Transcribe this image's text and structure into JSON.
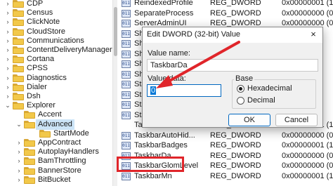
{
  "tree": {
    "items": [
      {
        "label": "CDP",
        "level": 1,
        "expanded": false
      },
      {
        "label": "Census",
        "level": 1,
        "expanded": false
      },
      {
        "label": "ClickNote",
        "level": 1,
        "expanded": false
      },
      {
        "label": "CloudStore",
        "level": 1,
        "expanded": false
      },
      {
        "label": "Communications",
        "level": 1,
        "expanded": false
      },
      {
        "label": "ContentDeliveryManager",
        "level": 1,
        "expanded": false
      },
      {
        "label": "Cortana",
        "level": 1,
        "expanded": false
      },
      {
        "label": "CPSS",
        "level": 1,
        "expanded": false
      },
      {
        "label": "Diagnostics",
        "level": 1,
        "expanded": false
      },
      {
        "label": "Dialer",
        "level": 1,
        "expanded": false
      },
      {
        "label": "Dsh",
        "level": 1,
        "expanded": false
      },
      {
        "label": "Explorer",
        "level": 1,
        "expanded": true
      },
      {
        "label": "Accent",
        "level": 2,
        "expanded": null
      },
      {
        "label": "Advanced",
        "level": 2,
        "expanded": true,
        "selected": true
      },
      {
        "label": "StartMode",
        "level": 3,
        "expanded": null
      },
      {
        "label": "AppContract",
        "level": 2,
        "expanded": false
      },
      {
        "label": "AutoplayHandlers",
        "level": 2,
        "expanded": false
      },
      {
        "label": "BamThrottling",
        "level": 2,
        "expanded": false
      },
      {
        "label": "BannerStore",
        "level": 2,
        "expanded": false
      },
      {
        "label": "BitBucket",
        "level": 2,
        "expanded": false
      }
    ]
  },
  "values": {
    "rows": [
      {
        "name": "ReindexedProfile",
        "type": "REG_DWORD",
        "data": "0x00000001 (1)",
        "icon": true
      },
      {
        "name": "SeparateProcess",
        "type": "REG_DWORD",
        "data": "0x00000000 (0)",
        "icon": true
      },
      {
        "name": "ServerAdminUI",
        "type": "REG_DWORD",
        "data": "0x00000000 (0)",
        "icon": true
      },
      {
        "name": "Sho",
        "type": "",
        "data": "",
        "icon": true
      },
      {
        "name": "Sho",
        "type": "",
        "data": "",
        "icon": true
      },
      {
        "name": "Sho",
        "type": "",
        "data": "",
        "icon": true
      },
      {
        "name": "Sho",
        "type": "",
        "data": "",
        "icon": true
      },
      {
        "name": "Sho",
        "type": "",
        "data": "",
        "icon": true
      },
      {
        "name": "Sta",
        "type": "",
        "data": "",
        "icon": true
      },
      {
        "name": "Sta",
        "type": "",
        "data": "",
        "icon": true
      },
      {
        "name": "Sta",
        "type": "",
        "data": "",
        "icon": true
      },
      {
        "name": "Sta",
        "type": "",
        "data": "",
        "icon": true
      },
      {
        "name": "TaskbarAl",
        "type": "REG_DWORD",
        "data": "0x00000001 (1)",
        "icon": false
      },
      {
        "name": "TaskbarAutoHid...",
        "type": "REG_DWORD",
        "data": "0x00000000 (0)",
        "icon": true
      },
      {
        "name": "TaskbarBadges",
        "type": "REG_DWORD",
        "data": "0x00000001 (1)",
        "icon": true
      },
      {
        "name": "TaskbarDa",
        "type": "REG_DWORD",
        "data": "0x00000000 (0)",
        "icon": true
      },
      {
        "name": "TaskbarGlomLevel",
        "type": "REG_DWORD",
        "data": "0x00000000 (0)",
        "icon": true
      },
      {
        "name": "TaskbarMn",
        "type": "REG_DWORD",
        "data": "0x00000001 (1)",
        "icon": true
      }
    ]
  },
  "dialog": {
    "title": "Edit DWORD (32-bit) Value",
    "close_glyph": "×",
    "value_name_label": "Value name:",
    "value_name": "TaskbarDa",
    "value_data_label": "Value data:",
    "value_data": "0",
    "base_label": "Base",
    "hex_label": "Hexadecimal",
    "dec_label": "Decimal",
    "base_selected": "Hexadecimal",
    "ok_label": "OK",
    "cancel_label": "Cancel"
  },
  "colors": {
    "annotation_red": "#e0252a",
    "selection_blue": "#0078d7",
    "folder_yellow": "#f2c84a"
  }
}
